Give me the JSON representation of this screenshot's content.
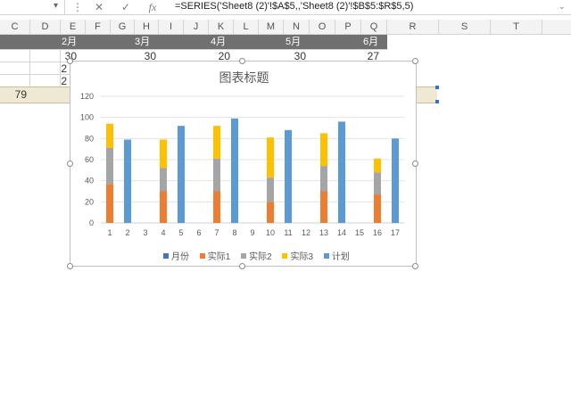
{
  "formula_bar": {
    "namebox_arrow": "▾",
    "more_glyph": "⋮",
    "cancel_glyph": "✕",
    "enter_glyph": "✓",
    "fx_label": "fx",
    "formula": "=SERIES('Sheet8 (2)'!$A$5,,'Sheet8 (2)'!$B$5:$R$5,5)"
  },
  "columns": [
    "C",
    "D",
    "E",
    "F",
    "G",
    "H",
    "I",
    "J",
    "K",
    "L",
    "M",
    "N",
    "O",
    "P",
    "Q",
    "R",
    "S",
    "T"
  ],
  "months": [
    "2月",
    "3月",
    "4月",
    "5月",
    "6月"
  ],
  "cells": {
    "e2": "30",
    "h2": "30",
    "k2": "20",
    "n2": "30",
    "q2": "27",
    "e3": "2",
    "e4": "2",
    "c5": "79"
  },
  "chart": {
    "title": "图表标题",
    "legend": [
      {
        "name": "月份",
        "color": "#4472C4"
      },
      {
        "name": "实际1",
        "color": "#ED7D31"
      },
      {
        "name": "实际2",
        "color": "#A5A5A5"
      },
      {
        "name": "实际3",
        "color": "#FFC000"
      },
      {
        "name": "计划",
        "color": "#5B9BD5"
      }
    ]
  },
  "chart_data": {
    "type": "bar",
    "stacked": true,
    "title": "图表标题",
    "categories": [
      "1",
      "2",
      "3",
      "4",
      "5",
      "6",
      "7",
      "8",
      "9",
      "10",
      "11",
      "12",
      "13",
      "14",
      "15",
      "16",
      "17"
    ],
    "ylim": [
      0,
      120
    ],
    "yticks": [
      0,
      20,
      40,
      60,
      80,
      100,
      120
    ],
    "grid": true,
    "legend_position": "bottom",
    "series": [
      {
        "name": "月份",
        "color": "#4472C4",
        "values": [
          0,
          0,
          0,
          0,
          0,
          0,
          0,
          0,
          0,
          0,
          0,
          0,
          0,
          0,
          0,
          0,
          0
        ]
      },
      {
        "name": "实际1",
        "color": "#ED7D31",
        "values": [
          37,
          0,
          0,
          30,
          0,
          0,
          30,
          0,
          0,
          20,
          0,
          0,
          30,
          0,
          0,
          27,
          0
        ]
      },
      {
        "name": "实际2",
        "color": "#A5A5A5",
        "values": [
          34,
          0,
          0,
          22,
          0,
          0,
          31,
          0,
          0,
          23,
          0,
          0,
          24,
          0,
          0,
          21,
          0
        ]
      },
      {
        "name": "实际3",
        "color": "#FFC000",
        "values": [
          23,
          0,
          0,
          27,
          0,
          0,
          31,
          0,
          0,
          38,
          0,
          0,
          31,
          0,
          0,
          13,
          0
        ]
      },
      {
        "name": "计划",
        "color": "#5B9BD5",
        "values": [
          0,
          79,
          0,
          0,
          92,
          0,
          0,
          99,
          0,
          0,
          88,
          0,
          0,
          96,
          0,
          0,
          80
        ]
      }
    ]
  }
}
